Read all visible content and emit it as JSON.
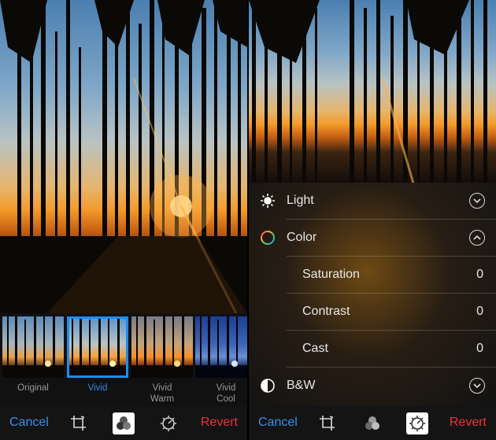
{
  "left": {
    "filters": [
      {
        "label": "Original",
        "selected": false
      },
      {
        "label": "Vivid",
        "selected": true
      },
      {
        "label": "Vivid\nWarm",
        "selected": false
      },
      {
        "label": "Vivid\nCool",
        "selected": false
      }
    ]
  },
  "toolbar": {
    "cancel_label": "Cancel",
    "revert_label": "Revert",
    "icons": [
      "crop-rotate-icon",
      "filters-icon",
      "adjust-dial-icon"
    ]
  },
  "panel": {
    "light_label": "Light",
    "color_label": "Color",
    "saturation_label": "Saturation",
    "saturation_value": "0",
    "contrast_label": "Contrast",
    "contrast_value": "0",
    "cast_label": "Cast",
    "cast_value": "0",
    "bw_label": "B&W"
  },
  "colors": {
    "accent": "#1d8cf3",
    "cancel": "#3a8fe8",
    "revert": "#e8343b"
  }
}
